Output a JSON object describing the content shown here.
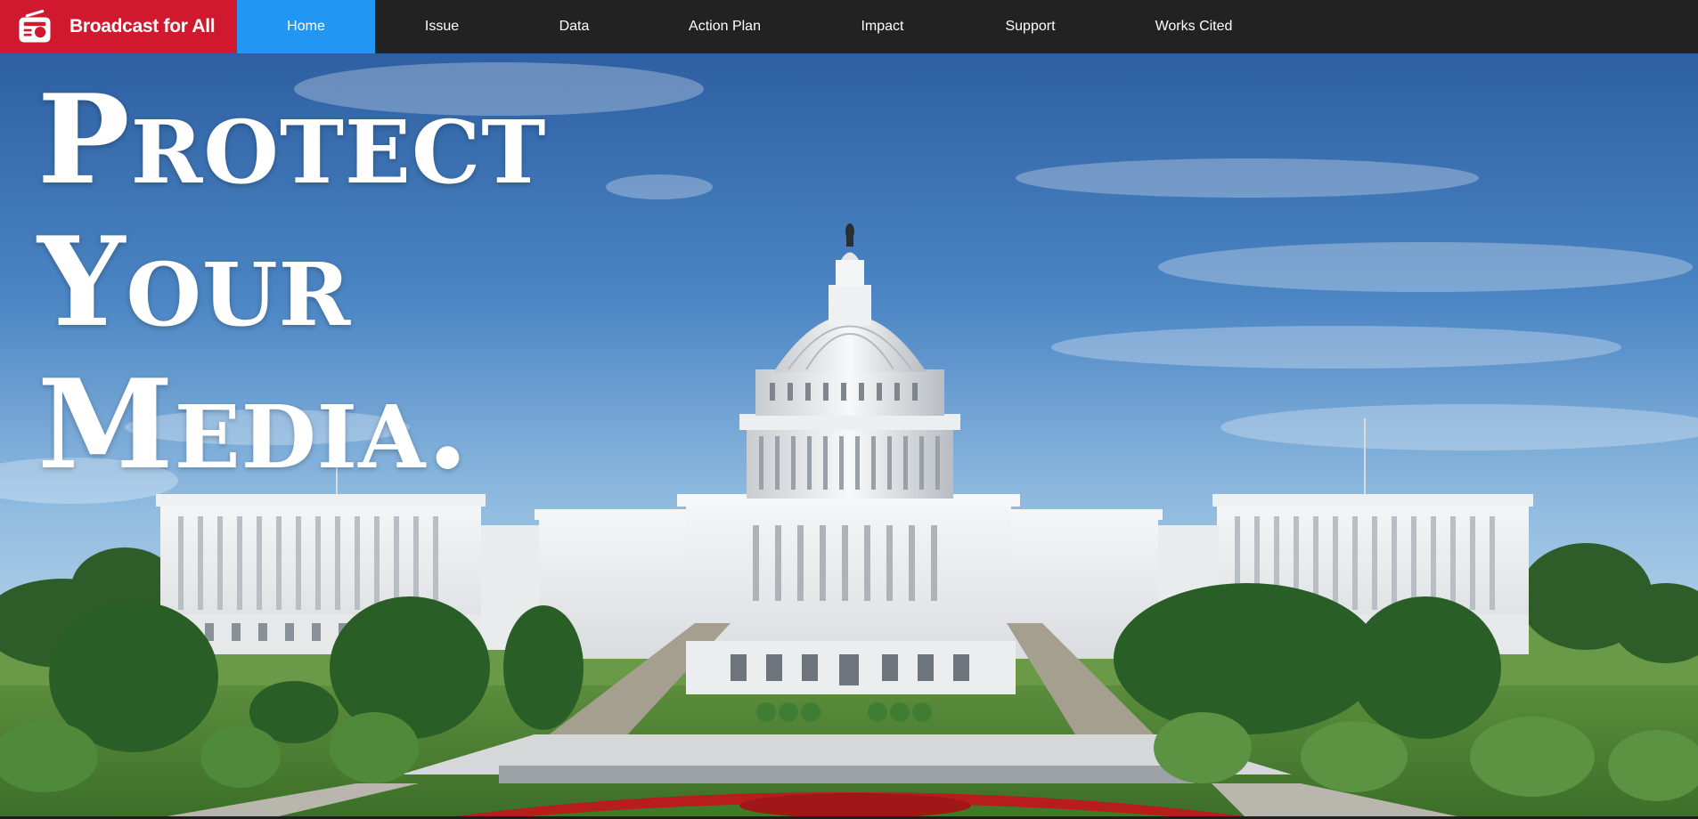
{
  "nav": {
    "brand": {
      "icon": "radio-icon",
      "label": "Broadcast for All",
      "color": "#d0192f"
    },
    "items": [
      {
        "label": "Home",
        "active": true
      },
      {
        "label": "Issue",
        "active": false
      },
      {
        "label": "Data",
        "active": false
      },
      {
        "label": "Action Plan",
        "active": false
      },
      {
        "label": "Impact",
        "active": false
      },
      {
        "label": "Support",
        "active": false
      },
      {
        "label": "Works Cited",
        "active": false
      }
    ],
    "active_color": "#2196f3",
    "bar_color": "#222222"
  },
  "hero": {
    "image": "us-capitol-building",
    "headline": {
      "line1": "Protect",
      "line2": "Your",
      "line3": "Media."
    }
  }
}
